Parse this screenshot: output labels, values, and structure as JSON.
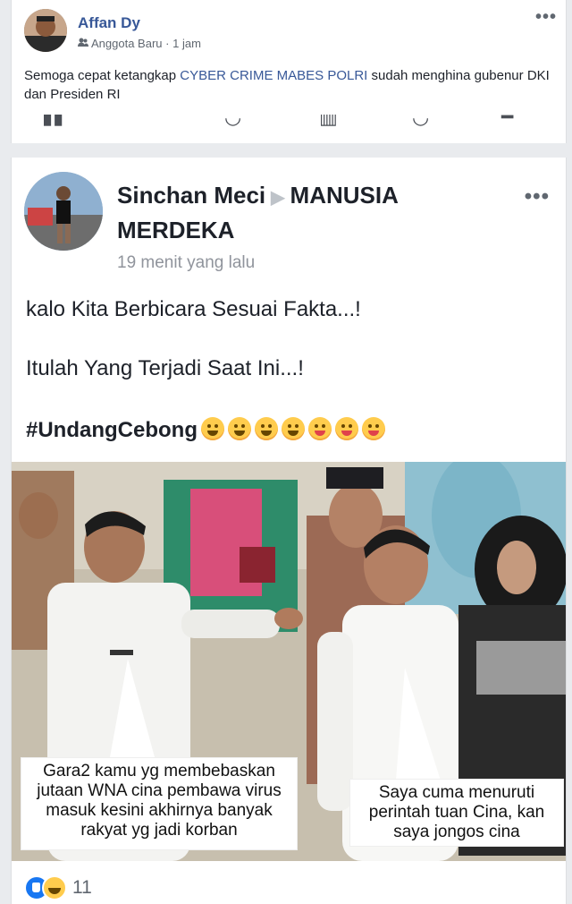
{
  "comment_card": {
    "author": "Affan Dy",
    "badge_icon": "group-member-icon",
    "role": "Anggota Baru",
    "separator": "·",
    "time": "1 jam",
    "more_icon": "•••",
    "text_before": "Semoga cepat ketangkap ",
    "text_highlight": "CYBER CRIME MABES POLRI",
    "text_after": " sudah menghina gubenur DKI dan Presiden RI"
  },
  "post": {
    "author": "Sinchan Meci",
    "arrow": "▶",
    "group": "MANUSIA MERDEKA",
    "more_icon": "•••",
    "time": "19 menit yang lalu",
    "line1": "kalo Kita Berbicara Sesuai Fakta...!",
    "line2": "Itulah Yang Terjadi Saat Ini...!",
    "hashtag": "#UndangCebong",
    "emojis": [
      "smiling-face",
      "grinning-face",
      "beaming-face",
      "rolling-laughing-face",
      "tongue-face",
      "winking-tongue-face",
      "tongue-face"
    ]
  },
  "photo": {
    "caption_left": "Gara2 kamu yg membebaskan jutaan WNA cina pembawa virus masuk kesini akhirnya banyak rakyat yg jadi korban",
    "caption_right": "Saya cuma menuruti perintah tuan Cina, kan saya jongos cina"
  },
  "reactions": {
    "icons": [
      "like-icon",
      "haha-icon"
    ],
    "count": "11"
  },
  "colors": {
    "link_blue": "#385898",
    "background": "#e9ebee",
    "like_blue": "#1877f2"
  }
}
